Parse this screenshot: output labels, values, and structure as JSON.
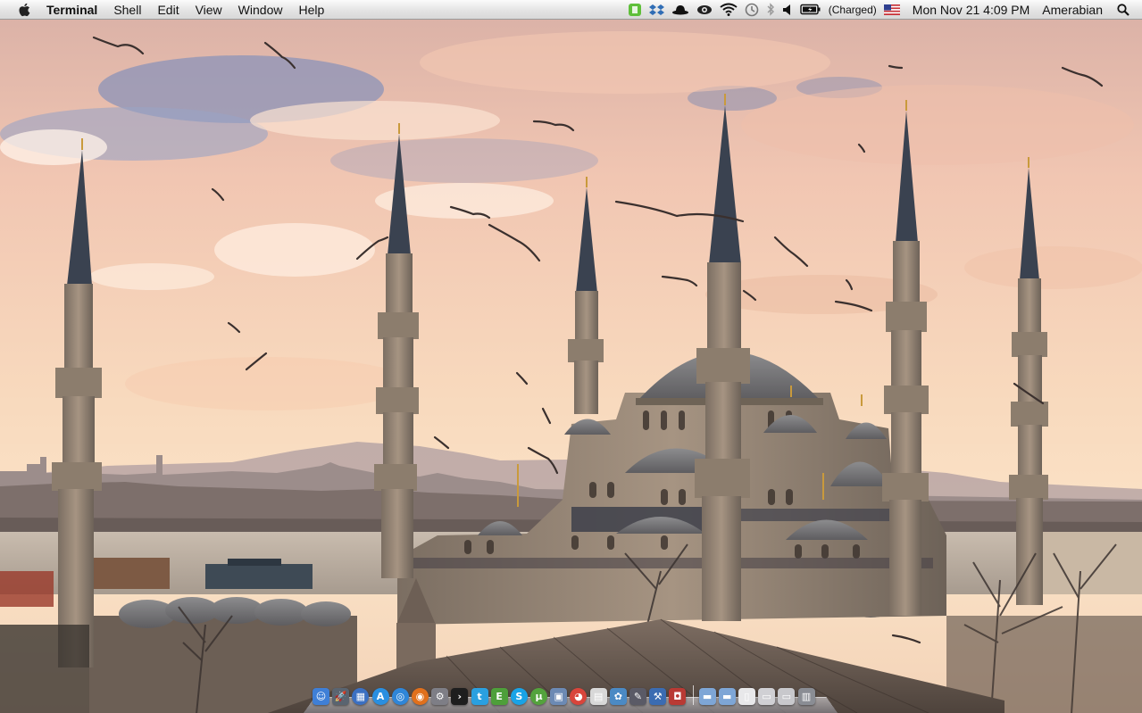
{
  "menubar": {
    "apple_icon": "apple-icon",
    "app_name": "Terminal",
    "menus": [
      "Shell",
      "Edit",
      "View",
      "Window",
      "Help"
    ],
    "status": {
      "battery_text": "(Charged)",
      "input_flag": "us-flag-icon",
      "clock": "Mon Nov 21  4:09 PM",
      "user": "Amerabian",
      "icons": [
        "evernote-icon",
        "dropbox-icon",
        "hat-icon",
        "eye-icon",
        "wifi-icon",
        "time-machine-icon",
        "bluetooth-icon",
        "volume-icon",
        "battery-icon",
        "spotlight-icon"
      ]
    }
  },
  "dock": {
    "apps": [
      {
        "name": "finder",
        "glyph": "☺",
        "color": "#3f7fd6"
      },
      {
        "name": "launchpad",
        "glyph": "🚀",
        "color": "#5a6470"
      },
      {
        "name": "mission-control",
        "glyph": "▦",
        "color": "#3b70c2"
      },
      {
        "name": "app-store",
        "glyph": "A",
        "color": "#2a8fe0"
      },
      {
        "name": "safari",
        "glyph": "◎",
        "color": "#2f86d8"
      },
      {
        "name": "firefox",
        "glyph": "◉",
        "color": "#e0701c"
      },
      {
        "name": "system-preferences",
        "glyph": "⚙",
        "color": "#7e7e86"
      },
      {
        "name": "terminal",
        "glyph": "›",
        "color": "#1e1e1e"
      },
      {
        "name": "twitter",
        "glyph": "t",
        "color": "#2aa0e0"
      },
      {
        "name": "evernote",
        "glyph": "E",
        "color": "#4e9f3a"
      },
      {
        "name": "skype",
        "glyph": "S",
        "color": "#1aa3e6"
      },
      {
        "name": "utorrent",
        "glyph": "µ",
        "color": "#54a33d"
      },
      {
        "name": "preview",
        "glyph": "▣",
        "color": "#6c8ab4"
      },
      {
        "name": "chrome",
        "glyph": "◕",
        "color": "#d9453b"
      },
      {
        "name": "ical",
        "glyph": "▤",
        "color": "#d8d8d8"
      },
      {
        "name": "iphoto",
        "glyph": "✿",
        "color": "#4b8ac4"
      },
      {
        "name": "pen",
        "glyph": "✎",
        "color": "#5a5a66"
      },
      {
        "name": "xcode",
        "glyph": "⚒",
        "color": "#3b6cb2"
      },
      {
        "name": "photo-booth",
        "glyph": "◘",
        "color": "#b93a34"
      }
    ],
    "stacks": [
      {
        "name": "applications-folder",
        "glyph": "▬",
        "color": "#7ea6d6"
      },
      {
        "name": "downloads-folder",
        "glyph": "▬",
        "color": "#7ea6d6"
      },
      {
        "name": "documents-stack",
        "glyph": "▯",
        "color": "#e8e8ea"
      },
      {
        "name": "window-stack",
        "glyph": "▭",
        "color": "#d0d0d4"
      },
      {
        "name": "minimized-window",
        "glyph": "▭",
        "color": "#c8c8cc"
      },
      {
        "name": "trash",
        "glyph": "▥",
        "color": "#8a8d94"
      }
    ]
  },
  "colors": {
    "sky_top": "#f3c7b0",
    "sky_bottom": "#f9ddc0",
    "mosque_stone": "#8a7a68",
    "sea": "#b8aea2"
  }
}
